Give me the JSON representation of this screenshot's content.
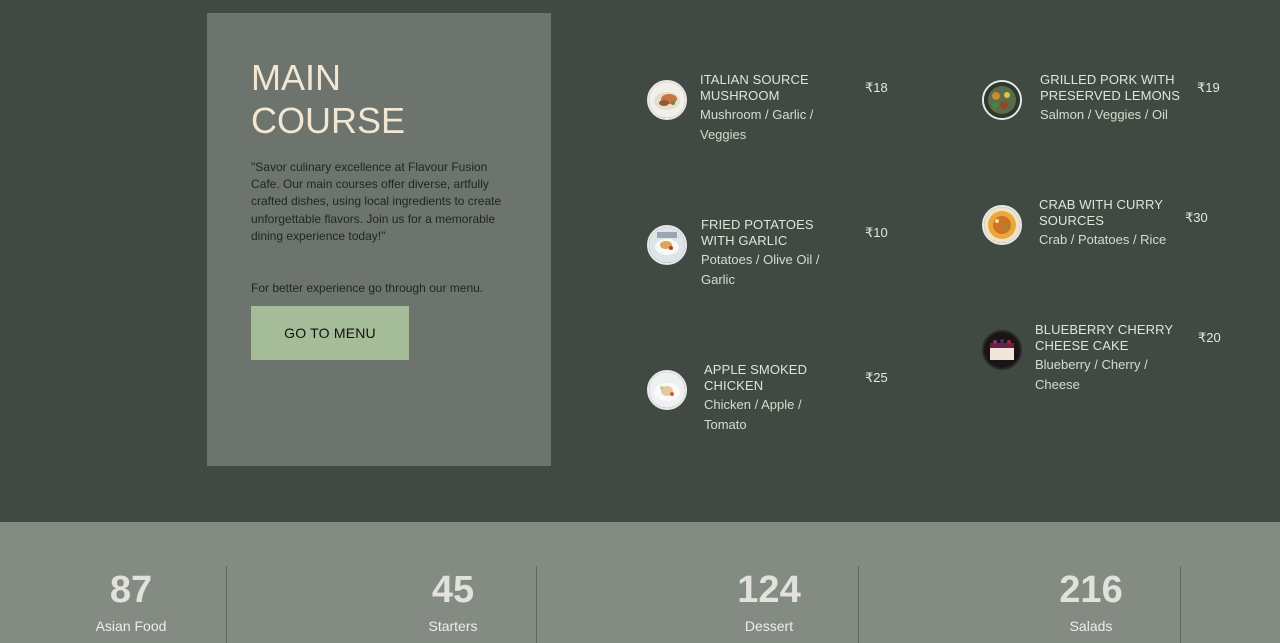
{
  "section": {
    "title_line1": "MAIN",
    "title_line2": "COURSE",
    "description": "\"Savor culinary excellence at Flavour Fusion Cafe. Our main courses offer diverse, artfully crafted dishes, using local ingredients to create unforgettable flavors. Join us for a memorable dining experience today!\"",
    "hint": "For better experience go through our menu.",
    "button_label": "GO TO MENU"
  },
  "dishes": [
    {
      "name": "ITALIAN SOURCE MUSHROOM",
      "ingredients": "Mushroom / Garlic / Veggies",
      "price": "₹18",
      "icon": "mushroom-dish-icon"
    },
    {
      "name": "FRIED POTATOES WITH GARLIC",
      "ingredients": "Potatoes / Olive Oil / Garlic",
      "price": "₹10",
      "icon": "potato-dish-icon"
    },
    {
      "name": "APPLE SMOKED CHICKEN",
      "ingredients": "Chicken / Apple / Tomato",
      "price": "₹25",
      "icon": "chicken-dish-icon"
    },
    {
      "name": "GRILLED PORK WITH PRESERVED LEMONS",
      "ingredients": "Salmon / Veggies / Oil",
      "price": "₹19",
      "icon": "pork-dish-icon"
    },
    {
      "name": "CRAB WITH CURRY SOURCES",
      "ingredients": "Crab / Potatoes / Rice",
      "price": "₹30",
      "icon": "crab-dish-icon"
    },
    {
      "name": "BLUEBERRY CHERRY CHEESE CAKE",
      "ingredients": "Blueberry / Cherry / Cheese",
      "price": "₹20",
      "icon": "cheesecake-dish-icon"
    }
  ],
  "stats": [
    {
      "value": "87",
      "label": "Asian Food"
    },
    {
      "value": "45",
      "label": "Starters"
    },
    {
      "value": "124",
      "label": "Dessert"
    },
    {
      "value": "216",
      "label": "Salads"
    }
  ],
  "colors": {
    "background": "#414a42",
    "card": "#6d736d",
    "title": "#f1e7d2",
    "button": "#a5bc98",
    "stats_band": "#848b82"
  }
}
